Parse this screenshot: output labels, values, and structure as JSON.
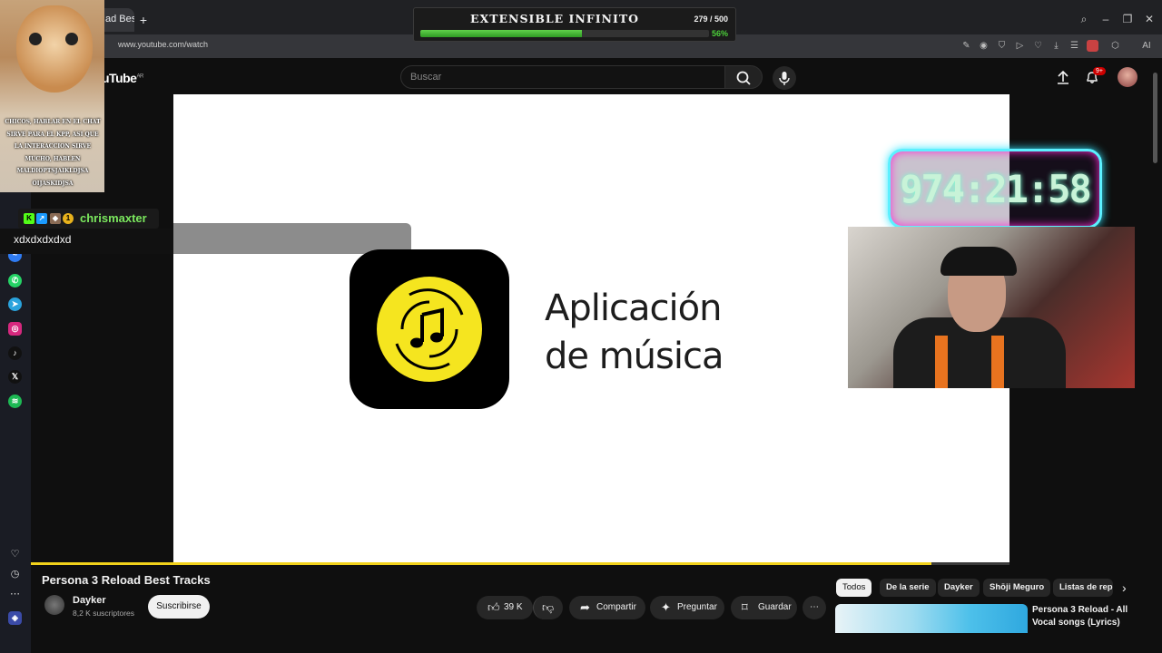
{
  "browser": {
    "tab_label": "ad Best",
    "new_tab": "+",
    "url": "www.youtube.com/watch",
    "window_controls": [
      "search-icon",
      "minimize-icon",
      "restore-icon",
      "close-icon"
    ],
    "ai_label": "AI"
  },
  "goal_overlay": {
    "title": "EXTENSIBLE INFINITO",
    "count": "279 / 500",
    "percent_label": "56%",
    "progress": 0.56
  },
  "youtube": {
    "logo": "uTube",
    "region": "AR",
    "search_placeholder": "Buscar",
    "notifications_badge": "9+"
  },
  "video": {
    "app_text_line1": "Aplicación",
    "app_text_line2": "de música",
    "played_fraction": 0.92
  },
  "cat_overlay": {
    "caption": "CHICOS, HABLAR EN EL CHAT SIRVE PARA EL KPP, ASI QUE LA INTERACCION SIRVE MUCHO, HABLEN MALDIOPTSJAIKLDJSA OIJASKIDJSA"
  },
  "chat": {
    "username": "chrismaxter",
    "message": "xdxdxdxdxd",
    "badge_number": "1"
  },
  "timer": {
    "value": "974:21:58"
  },
  "info": {
    "title": "Persona 3 Reload Best Tracks",
    "channel": "Dayker",
    "subscribers": "8,2 K suscriptores",
    "subscribe_label": "Suscribirse",
    "likes": "39 K",
    "share_label": "Compartir",
    "ask_label": "Preguntar",
    "save_label": "Guardar"
  },
  "chips": [
    "Todos",
    "De la serie",
    "Dayker",
    "Shōji Meguro",
    "Listas de rep"
  ],
  "recommendation": {
    "title": "Persona 3 Reload - All Vocal songs (Lyrics)"
  },
  "colors": {
    "accent_green": "#4ccf3a",
    "chat_name": "#7be85e",
    "app_yellow": "#f5e51f",
    "timer_glow": "#5cf0ff"
  }
}
